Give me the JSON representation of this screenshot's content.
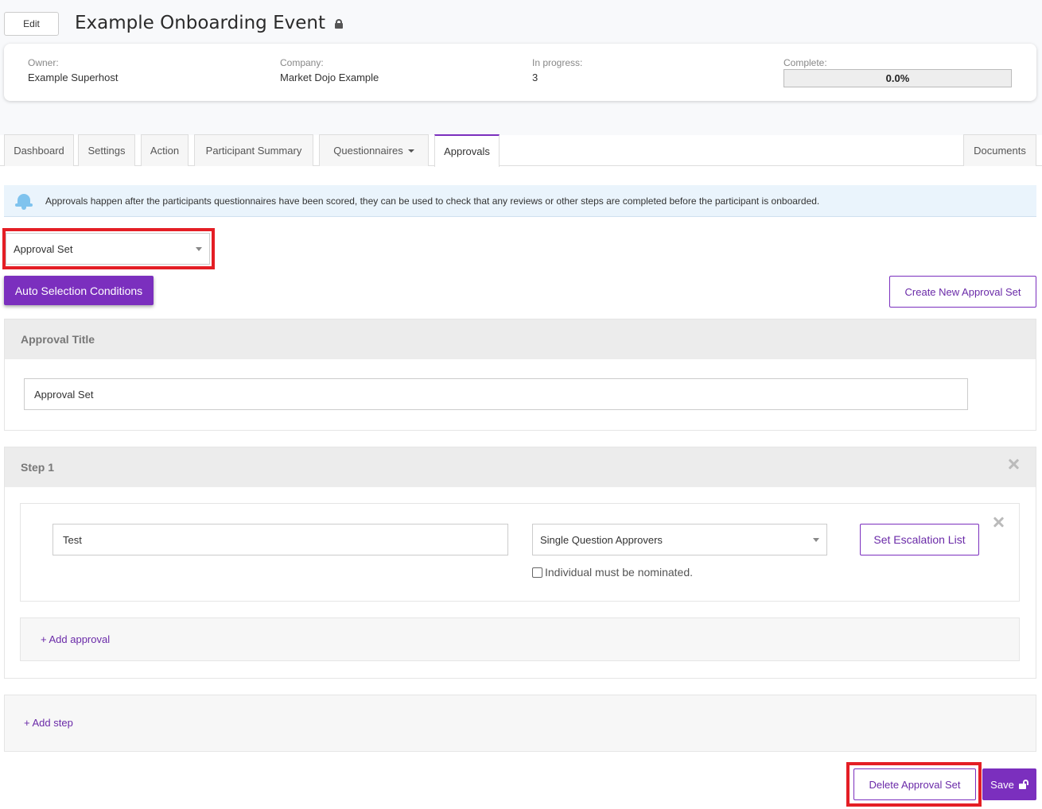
{
  "header": {
    "edit_label": "Edit",
    "title": "Example Onboarding Event"
  },
  "info": {
    "owner_label": "Owner:",
    "owner_value": "Example Superhost",
    "company_label": "Company:",
    "company_value": "Market Dojo Example",
    "in_progress_label": "In progress:",
    "in_progress_value": "3",
    "complete_label": "Complete:",
    "complete_value": "0.0%",
    "complete_fraction": 0.0
  },
  "tabs": [
    {
      "label": "Dashboard"
    },
    {
      "label": "Settings"
    },
    {
      "label": "Action"
    },
    {
      "label": "Participant Summary"
    },
    {
      "label": "Questionnaires"
    },
    {
      "label": "Approvals"
    },
    {
      "label": "Documents"
    }
  ],
  "active_tab": "Approvals",
  "banner": {
    "text": "Approvals happen after the participants questionnaires have been scored, they can be used to check that any reviews or other steps are completed before the participant is onboarded."
  },
  "approval_set_select": {
    "value": "Approval Set"
  },
  "buttons": {
    "auto_selection": "Auto Selection Conditions",
    "create_new": "Create New Approval Set",
    "set_escalation": "Set Escalation List",
    "delete": "Delete Approval Set",
    "save": "Save"
  },
  "approval_title_panel": {
    "heading": "Approval Title",
    "input_value": "Approval Set"
  },
  "step": {
    "heading": "Step 1",
    "approval_name": "Test",
    "approver_type": "Single Question Approvers",
    "nominate_label": "Individual must be nominated.",
    "nominate_checked": false,
    "add_approval": "+ Add approval"
  },
  "add_step": "+ Add step",
  "colors": {
    "accent": "#7b2fbe",
    "highlight": "#e41e25",
    "banner_bg": "#eaf4fc"
  }
}
